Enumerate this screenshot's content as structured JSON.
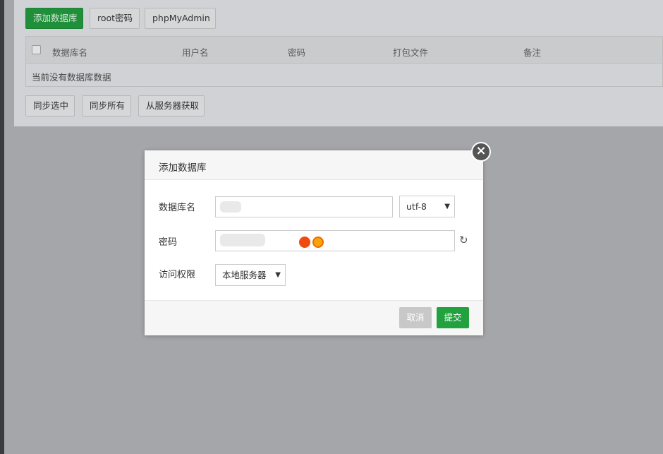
{
  "toolbar": {
    "add_db": "添加数据库",
    "root_pw": "root密码",
    "phpmyadmin": "phpMyAdmin"
  },
  "table": {
    "headers": [
      "数据库名",
      "用户名",
      "密码",
      "打包文件",
      "备注"
    ],
    "empty_text": "当前没有数据库数据"
  },
  "bottom_buttons": {
    "sync_selected": "同步选中",
    "sync_all": "同步所有",
    "fetch_server": "从服务器获取"
  },
  "modal": {
    "title": "添加数据库",
    "close_symbol": "×",
    "fields": {
      "db_name_label": "数据库名",
      "charset_value": "utf-8",
      "password_label": "密码",
      "access_label": "访问权限",
      "access_value": "本地服务器"
    },
    "refresh_symbol": "↻",
    "cancel": "取消",
    "submit": "提交"
  },
  "colors": {
    "primary_green": "#22a13f",
    "overlay": "#a5a6aa"
  }
}
